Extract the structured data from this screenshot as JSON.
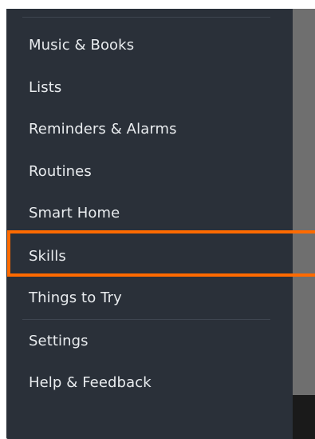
{
  "drawer": {
    "items": [
      {
        "label": "Music & Books"
      },
      {
        "label": "Lists"
      },
      {
        "label": "Reminders & Alarms"
      },
      {
        "label": "Routines"
      },
      {
        "label": "Smart Home"
      },
      {
        "label": "Skills"
      },
      {
        "label": "Things to Try"
      },
      {
        "label": "Settings"
      },
      {
        "label": "Help & Feedback"
      }
    ]
  },
  "highlight": {
    "target_label": "Skills",
    "color": "#ff6a00"
  },
  "colors": {
    "drawer_bg": "#2a3039",
    "text": "#e9ecef",
    "scrim": "#6f6f6f"
  }
}
